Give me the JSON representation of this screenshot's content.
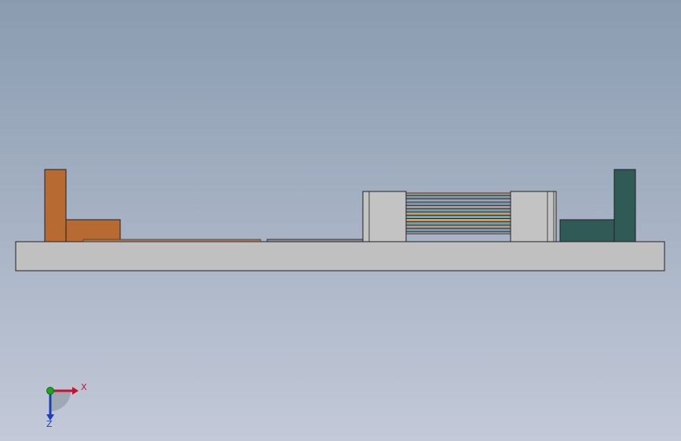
{
  "colors": {
    "background_top": "#8a9bb0",
    "background_bottom": "#c3c9d8",
    "base_plate": "#c0c0c0",
    "left_part": "#b86a33",
    "right_part": "#2f5a55",
    "center_block": "#c3c3c3",
    "stripe_orange": "#d98840",
    "stripe_teal": "#3a9a9a",
    "stripe_dark": "#1e1e1e",
    "axis_x": "#c8102e",
    "axis_y": "#1fa31f",
    "axis_z": "#1c3fb8"
  },
  "triad": {
    "x_label": "X",
    "z_label": "Z"
  }
}
